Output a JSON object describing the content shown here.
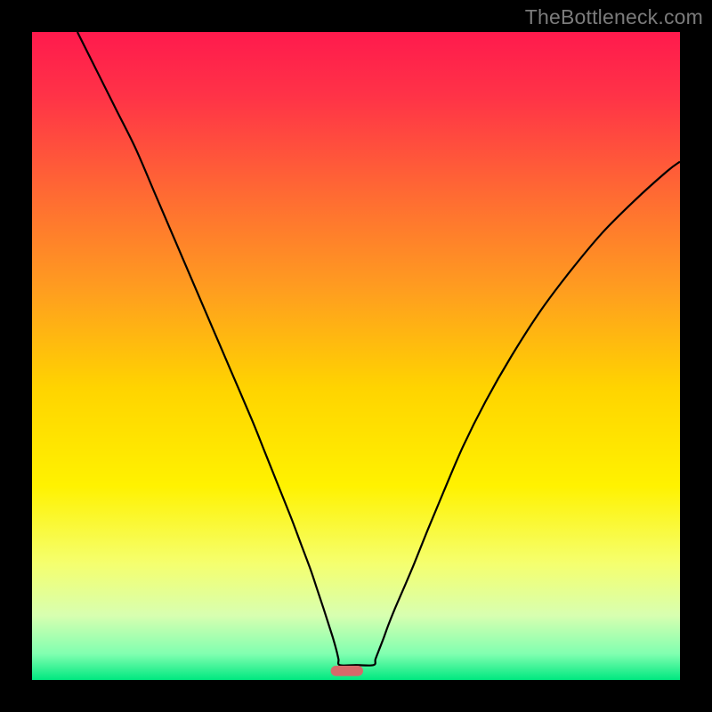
{
  "watermark": "TheBottleneck.com",
  "chart_data": {
    "type": "line",
    "title": "",
    "xlabel": "",
    "ylabel": "",
    "xlim": [
      0,
      100
    ],
    "ylim": [
      0,
      100
    ],
    "grid": false,
    "legend": false,
    "gradient_stops": [
      {
        "offset": 0.0,
        "color": "#ff1a4d"
      },
      {
        "offset": 0.1,
        "color": "#ff3347"
      },
      {
        "offset": 0.25,
        "color": "#ff6a33"
      },
      {
        "offset": 0.4,
        "color": "#ff9e1f"
      },
      {
        "offset": 0.55,
        "color": "#ffd400"
      },
      {
        "offset": 0.7,
        "color": "#fff200"
      },
      {
        "offset": 0.82,
        "color": "#f5ff6e"
      },
      {
        "offset": 0.9,
        "color": "#d8ffb0"
      },
      {
        "offset": 0.96,
        "color": "#80ffb0"
      },
      {
        "offset": 1.0,
        "color": "#00e880"
      }
    ],
    "series": [
      {
        "name": "bottleneck-curve",
        "color": "#000000",
        "width": 2.2,
        "x": [
          7,
          10,
          13,
          16,
          19,
          22,
          25,
          28,
          31,
          34,
          36,
          38,
          40,
          41.5,
          43,
          44,
          45,
          45.8,
          46.5,
          47,
          47.3,
          47.5,
          50,
          52.7,
          53,
          53.5,
          54.2,
          55,
          56,
          57.3,
          59,
          61,
          63.5,
          66.5,
          70,
          74,
          78.5,
          83,
          88,
          93,
          98,
          100
        ],
        "y": [
          100,
          94,
          88,
          82,
          75,
          68,
          61,
          54,
          47,
          40,
          35,
          30,
          25,
          21,
          17,
          14,
          11,
          8.5,
          6.3,
          4.5,
          3.2,
          2.3,
          2.3,
          2.3,
          3.2,
          4.5,
          6.3,
          8.5,
          11,
          14,
          18,
          23,
          29,
          36,
          43,
          50,
          57,
          63,
          69,
          74,
          78.5,
          80
        ]
      }
    ],
    "marker": {
      "name": "vertex-marker",
      "x": 48.6,
      "y": 1.4,
      "w": 5.0,
      "h": 1.6,
      "rx": 0.8,
      "fill": "#d66a6a"
    }
  }
}
